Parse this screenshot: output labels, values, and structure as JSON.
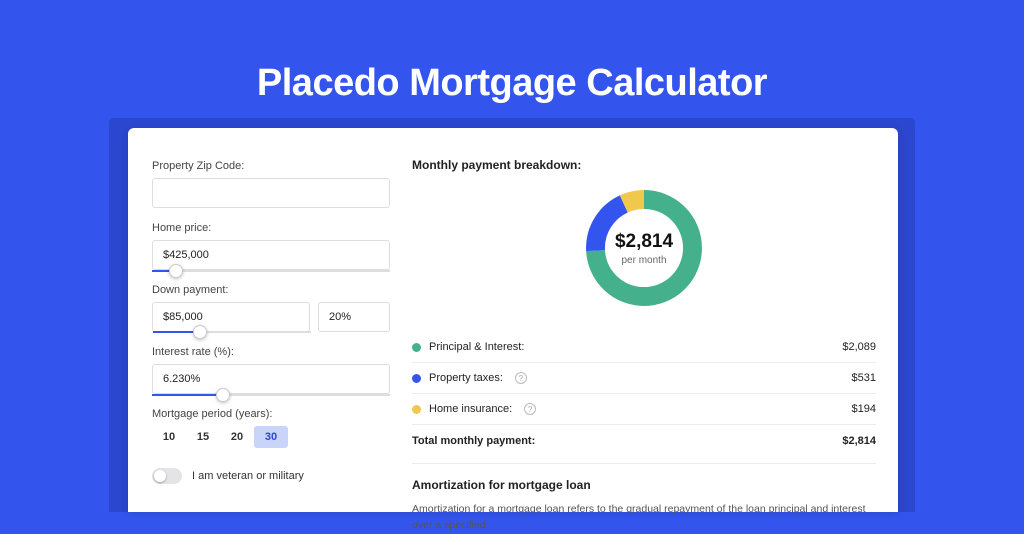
{
  "title": "Placedo Mortgage Calculator",
  "colors": {
    "accent": "#3355ee",
    "green": "#45b08c",
    "blue": "#3355ee",
    "yellow": "#f0c84b"
  },
  "form": {
    "zip_label": "Property Zip Code:",
    "zip_value": "",
    "home_price_label": "Home price:",
    "home_price_value": "$425,000",
    "home_price_slider_pct": 10,
    "down_payment_label": "Down payment:",
    "down_payment_value": "$85,000",
    "down_payment_pct": "20%",
    "down_payment_slider_pct": 30,
    "interest_label": "Interest rate (%):",
    "interest_value": "6.230%",
    "interest_slider_pct": 30,
    "period_label": "Mortgage period (years):",
    "periods": [
      "10",
      "15",
      "20",
      "30"
    ],
    "period_selected_index": 3,
    "veteran_label": "I am veteran or military",
    "veteran_on": false
  },
  "breakdown": {
    "heading": "Monthly payment breakdown:",
    "center_amount": "$2,814",
    "center_sub": "per month",
    "items": [
      {
        "label": "Principal & Interest:",
        "value": "$2,089",
        "color": "g",
        "dash": 74,
        "info": false
      },
      {
        "label": "Property taxes:",
        "value": "$531",
        "color": "b",
        "dash": 19,
        "info": true
      },
      {
        "label": "Home insurance:",
        "value": "$194",
        "color": "y",
        "dash": 7,
        "info": true
      }
    ],
    "total_label": "Total monthly payment:",
    "total_value": "$2,814"
  },
  "amort": {
    "heading": "Amortization for mortgage loan",
    "body": "Amortization for a mortgage loan refers to the gradual repayment of the loan principal and interest over a specified"
  },
  "chart_data": {
    "type": "pie",
    "title": "Monthly payment breakdown",
    "series": [
      {
        "name": "Principal & Interest",
        "value": 2089
      },
      {
        "name": "Property taxes",
        "value": 531
      },
      {
        "name": "Home insurance",
        "value": 194
      }
    ],
    "total": 2814,
    "unit": "USD/month"
  }
}
